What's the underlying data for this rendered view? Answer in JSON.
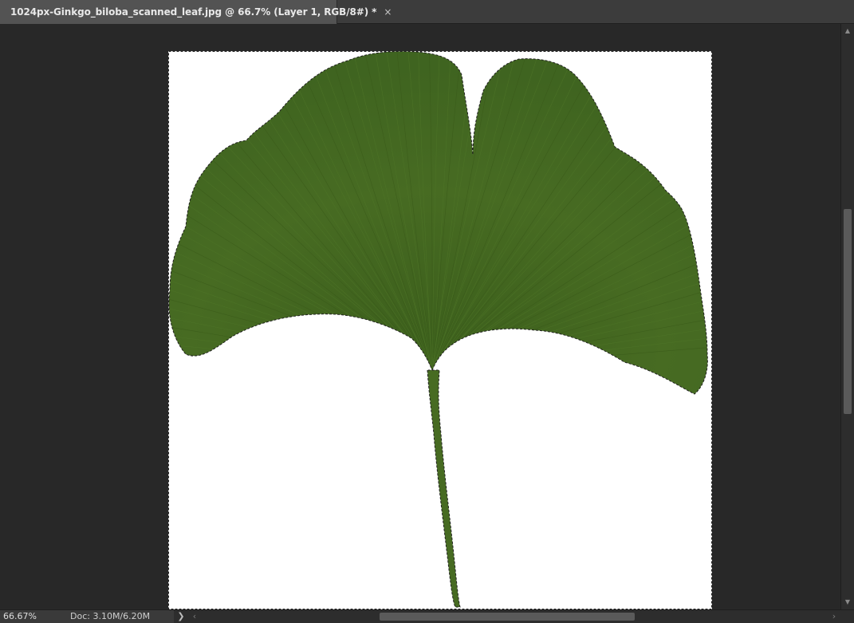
{
  "document_tab": {
    "title": "1024px-Ginkgo_biloba_scanned_leaf.jpg @ 66.7% (Layer 1, RGB/8#) *",
    "close_glyph": "×"
  },
  "canvas": {
    "image_subject": "ginkgo-leaf",
    "leaf_color": "#476b22",
    "background_color": "#ffffff",
    "selection": "marching-ants"
  },
  "status_bar": {
    "zoom": "66.67%",
    "doc_size": "Doc: 3.10M/6.20M",
    "menu_arrow": "❯"
  },
  "scrollbars": {
    "vertical_position": 0.4,
    "horizontal_position": 0.45,
    "up_glyph": "▲",
    "down_glyph": "▼",
    "left_glyph": "‹",
    "right_glyph": "›"
  },
  "colors": {
    "workspace": "#282828",
    "tab_active": "#535353",
    "accent_leaf_dark": "#3a5a1a",
    "accent_leaf_light": "#567d2c"
  }
}
